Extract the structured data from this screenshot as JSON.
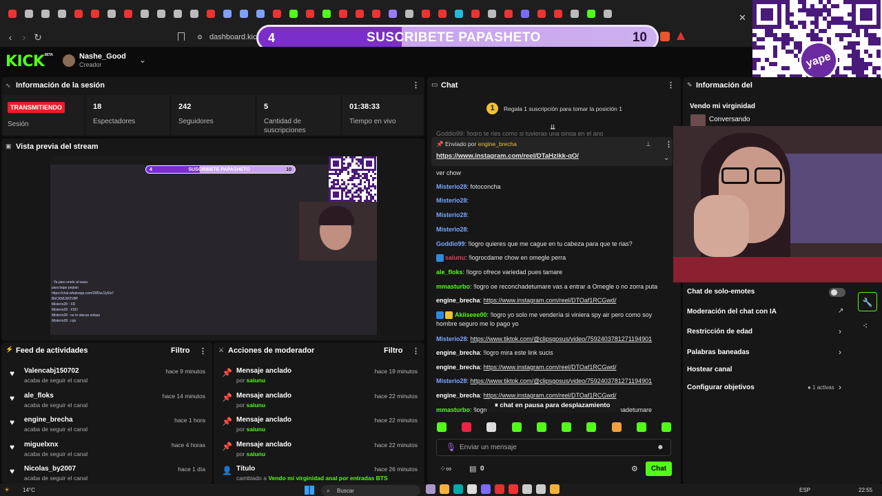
{
  "browser": {
    "url": "dashboard.kick.",
    "tab_colors": [
      "#e33",
      "#bbb",
      "#bbb",
      "#bbb",
      "#e33",
      "#e33",
      "#bbb",
      "#e33",
      "#bbb",
      "#bbb",
      "#bbb",
      "#bbb",
      "#e33",
      "#7fa0ff",
      "#7fa0ff",
      "#7fa0ff",
      "#e33",
      "#53fc18",
      "#e33",
      "#53fc18",
      "#e33",
      "#e33",
      "#e33",
      "#9a7bff",
      "#bbb",
      "#e33",
      "#e33",
      "#2bd",
      "#e33",
      "#bbb",
      "#e33",
      "#7b6bff",
      "#e33",
      "#e33",
      "#bbb",
      "#53fc18",
      "#bbb"
    ]
  },
  "banner": {
    "number": "4",
    "text": "SUSCRIBETE PAPASHETO",
    "count": "10"
  },
  "header": {
    "logo": "KICK",
    "logo_sup": "BETA",
    "username": "Nashe_Good",
    "role": "Creador"
  },
  "session": {
    "title": "Información de la sesión",
    "status_badge": "TRANSMITIENDO",
    "status_label": "Sesión",
    "stats": [
      {
        "value": "18",
        "label": "Espectadores"
      },
      {
        "value": "242",
        "label": "Seguidores"
      },
      {
        "value": "5",
        "label": "Cantidad de suscripciones"
      },
      {
        "value": "01:38:33",
        "label": "Tiempo en vivo"
      }
    ]
  },
  "preview": {
    "title": "Vista previa del stream",
    "mini_banner": "SUSCRIBETE PAPASHETO",
    "mini_num": "4",
    "mini_count": "10",
    "mini_chat": [
      ": Ya paro unete al waza",
      "para bajar pepian",
      "https://chat.whatsapp.com/D8DwJJy6Is7",
      "BbCKMLWOVBP",
      "Misterio28 : XD",
      "Misterio28 : XDD",
      "Misterio28 : oe te alacas solaas",
      "Misterio28 : crjo"
    ]
  },
  "activity_feed": {
    "title": "Feed de actividades",
    "filter": "Filtro",
    "items": [
      {
        "name": "Valencabj150702",
        "sub": "acaba de seguir el canal",
        "time": "hace 9 minutos"
      },
      {
        "name": "ale_floks",
        "sub": "acaba de seguir el canal",
        "time": "hace 14 minutos"
      },
      {
        "name": "engine_brecha",
        "sub": "acaba de seguir el canal",
        "time": "hace 1 hora"
      },
      {
        "name": "miguelxnx",
        "sub": "acaba de seguir el canal",
        "time": "hace 4 horas"
      },
      {
        "name": "Nicolas_by2007",
        "sub": "acaba de seguir el canal",
        "time": "hace 1 día"
      }
    ]
  },
  "mod_actions": {
    "title": "Acciones de moderador",
    "filter": "Filtro",
    "items": [
      {
        "name": "Mensaje anclado",
        "by": "por",
        "user": "saiunu",
        "time": "hace 19 minutos"
      },
      {
        "name": "Mensaje anclado",
        "by": "por",
        "user": "saiunu",
        "time": "hace 22 minutos"
      },
      {
        "name": "Mensaje anclado",
        "by": "por",
        "user": "saiunu",
        "time": "hace 22 minutos"
      },
      {
        "name": "Mensaje anclado",
        "by": "por",
        "user": "saiunu",
        "time": "hace 22 minutos"
      },
      {
        "name": "Título",
        "by": "cambiado a",
        "user": "Vendo mi virginidad anal por entradas BTS por",
        "time": "hace 26 minutos"
      }
    ]
  },
  "chat": {
    "title": "Chat",
    "gift_number": "1",
    "gift_text": "Regala 1 suscripción para tomar la posición 1",
    "cut_message": "Goddio99: !logro te ries como si tuvieras una pinga en el ano",
    "pinned_by_label": "Enviado por",
    "pinned_by": "engine_brecha",
    "pinned_link": "https://www.instagram.com/reel/DTaHzikk-qO/",
    "partial_top": "ver chow",
    "messages": [
      {
        "user": "Misterio28",
        "color": "#7aa7ff",
        "text": "fotoconcha",
        "link": "",
        "emote": false
      },
      {
        "user": "Misterio28",
        "color": "#7aa7ff",
        "text": "",
        "link": "",
        "emote": true
      },
      {
        "user": "Misterio28",
        "color": "#7aa7ff",
        "text": "",
        "link": "",
        "emote": true
      },
      {
        "user": "Misterio28",
        "color": "#7aa7ff",
        "text": "",
        "link": "",
        "emote": true
      },
      {
        "user": "Goddio99",
        "color": "#7aa7ff",
        "text": "!logro quieres que me cague en tu cabeza para que te rias?",
        "link": "",
        "emote": false
      },
      {
        "user": "saiunu",
        "color": "#e0405a",
        "text": "!logrocdame chow en omegle perra",
        "link": "",
        "emote": false
      },
      {
        "user": "ale_floks",
        "color": "#53fc18",
        "text": "!logro ofrece variedad pues tamare",
        "link": "",
        "emote": false
      },
      {
        "user": "mmasturbo",
        "color": "#53fc18",
        "text": "!logro oe reconchadetumare vas a entrar a Omegle o no zorra puta",
        "link": "",
        "emote": false
      },
      {
        "user": "engine_brecha",
        "color": "#ffffff",
        "text": "",
        "link": "https://www.instagram.com/reel/DTOaf1RCGwd/",
        "emote": false
      },
      {
        "user": "Akiiseee00",
        "color": "#53fc18",
        "text": "!logro yo solo me vendería si viniera spy air pero como soy",
        "text2": "hombre seguro me lo pago yo",
        "link": "",
        "emote": false
      },
      {
        "user": "Misterio28",
        "color": "#7aa7ff",
        "text": "",
        "link": "https://www.tiktok.com/@clipsgosus/video/7592403781271194901",
        "emote": false
      },
      {
        "user": "engine_brecha",
        "color": "#ffffff",
        "text": "!logro mira este link sucis",
        "link": "",
        "emote": false
      },
      {
        "user": "engine_brecha",
        "color": "#ffffff",
        "text": "",
        "link": "https://www.instagram.com/reel/DTOaf1RCGwd/",
        "emote": false
      },
      {
        "user": "Misterio28",
        "color": "#7aa7ff",
        "text": "",
        "link": "https://www.tiktok.com/@clipsgosus/video/7592403781271194901",
        "emote": false
      },
      {
        "user": "engine_brecha",
        "color": "#ffffff",
        "text": "",
        "link": "https://www.instagram.com/reel/DTOaf1RCGwd/",
        "emote": false
      },
      {
        "user": "mmasturbo",
        "color": "#53fc18",
        "text": "!logro",
        "tail": "nadetumare",
        "link": "",
        "emote": false
      }
    ],
    "paused_text": "chat en pausa para desplazamiento",
    "input_placeholder": "Enviar un mensaje",
    "viewer_count": "0",
    "send_button": "Chat"
  },
  "stream_info": {
    "title": "Información del st",
    "stream_title": "Vendo mi virginidad",
    "category": "Conversando",
    "items": [
      {
        "label": "Chat de solo-emotes",
        "control": "toggle"
      },
      {
        "label": "Moderación del chat con IA",
        "control": "external"
      },
      {
        "label": "Restricción de edad",
        "control": "chevron"
      },
      {
        "label": "Palabras baneadas",
        "control": "chevron"
      },
      {
        "label": "Hostear canal",
        "control": "none"
      },
      {
        "label": "Configurar objetivos",
        "control": "chevron",
        "badge": "1 activas"
      }
    ]
  },
  "taskbar": {
    "weather": "14°C",
    "search": "Buscar",
    "lang": "ESP",
    "time": "22:55"
  }
}
